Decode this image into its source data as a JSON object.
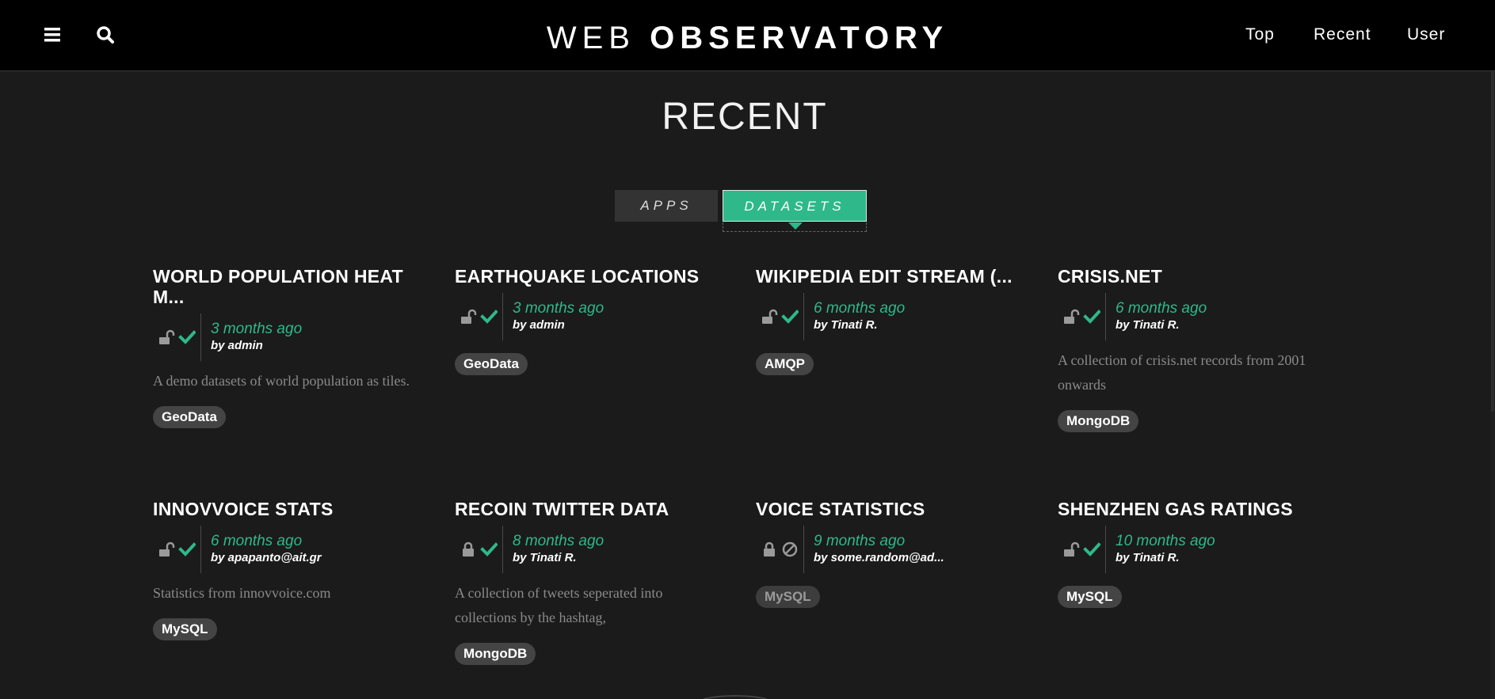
{
  "header": {
    "brand_light": "WEB ",
    "brand_bold": "OBSERVATORY",
    "menu_icon": "hamburger-icon",
    "search_icon": "search-icon",
    "nav": {
      "top": "Top",
      "recent": "Recent",
      "user": "User"
    }
  },
  "page": {
    "title": "RECENT",
    "tabs": {
      "apps": "APPS",
      "datasets": "DATASETS",
      "active": "datasets"
    }
  },
  "colors": {
    "accent": "#2fb88a",
    "background": "#1b1b1b",
    "topbar": "#000000",
    "tag_bg": "#444444"
  },
  "cards": [
    {
      "title": "WORLD POPULATION HEAT M...",
      "time": "3 months ago",
      "by": "by admin",
      "lock": "unlocked",
      "status": "check",
      "description": "A demo datasets of world population as tiles.",
      "tag": "GeoData"
    },
    {
      "title": "EARTHQUAKE LOCATIONS",
      "time": "3 months ago",
      "by": "by admin",
      "lock": "unlocked",
      "status": "check",
      "description": "",
      "tag": "GeoData"
    },
    {
      "title": "WIKIPEDIA EDIT STREAM (...",
      "time": "6 months ago",
      "by": "by Tinati R.",
      "lock": "unlocked",
      "status": "check",
      "description": "",
      "tag": "AMQP"
    },
    {
      "title": "CRISIS.NET",
      "time": "6 months ago",
      "by": "by Tinati R.",
      "lock": "unlocked",
      "status": "check",
      "description": "A collection of crisis.net records from 2001 onwards",
      "tag": "MongoDB"
    },
    {
      "title": "INNOVVOICE STATS",
      "time": "6 months ago",
      "by": "by apapanto@ait.gr",
      "lock": "unlocked",
      "status": "check",
      "description": "Statistics from innovvoice.com",
      "tag": "MySQL"
    },
    {
      "title": "RECOIN TWITTER DATA",
      "time": "8 months ago",
      "by": "by Tinati R.",
      "lock": "locked",
      "status": "check",
      "description": "A collection of tweets seperated into collections by the hashtag,",
      "tag": "MongoDB"
    },
    {
      "title": "VOICE STATISTICS",
      "time": "9 months ago",
      "by": "by some.random@ad...",
      "lock": "locked",
      "status": "blocked",
      "description": "",
      "tag": "MySQL"
    },
    {
      "title": "SHENZHEN GAS RATINGS",
      "time": "10 months ago",
      "by": "by Tinati R.",
      "lock": "unlocked",
      "status": "check",
      "description": "",
      "tag": "MySQL"
    }
  ]
}
